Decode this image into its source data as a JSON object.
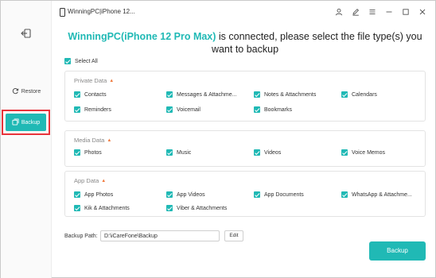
{
  "window": {
    "device_title": "WinningPC|iPhone 12..."
  },
  "sidebar": {
    "restore_label": "Restore",
    "backup_label": "Backup"
  },
  "heading": {
    "device": "WinningPC(iPhone 12 Pro Max)",
    "text": " is connected, please select the file type(s) you want to backup"
  },
  "select_all_label": "Select All",
  "groups": [
    {
      "title": "Private Data",
      "items": [
        "Contacts",
        "Messages & Attachme...",
        "Notes & Attachments",
        "Calendars",
        "Reminders",
        "Voicemail",
        "Bookmarks"
      ]
    },
    {
      "title": "Media Data",
      "items": [
        "Photos",
        "Music",
        "Videos",
        "Voice Memos"
      ]
    },
    {
      "title": "App Data",
      "items": [
        "App Photos",
        "App Videos",
        "App Documents",
        "WhatsApp & Attachme...",
        "Kik & Attachments",
        "Viber & Attachments"
      ]
    }
  ],
  "backup_path": {
    "label": "Backup Path:",
    "value": "D:\\iCareFone\\Backup",
    "edit_label": "Edit"
  },
  "backup_button_label": "Backup",
  "colors": {
    "accent": "#20b9b5",
    "highlight_border": "#e8333b",
    "hot_badge": "#f07b3f"
  },
  "icons": [
    "back-icon",
    "restore-icon",
    "backup-icon",
    "device-icon",
    "user-icon",
    "edit-icon",
    "menu-icon",
    "minimize-icon",
    "maximize-icon",
    "close-icon",
    "hot-icon",
    "checkbox-checked-icon"
  ]
}
